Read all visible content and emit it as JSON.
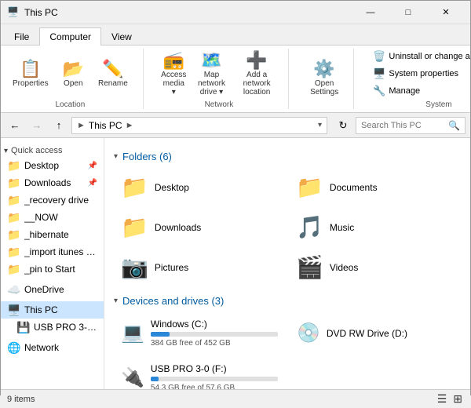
{
  "titleBar": {
    "title": "This PC",
    "icon": "🖥️",
    "minBtn": "—",
    "maxBtn": "□",
    "closeBtn": "✕"
  },
  "ribbon": {
    "tabs": [
      "File",
      "Computer",
      "View"
    ],
    "activeTab": "Computer",
    "groups": {
      "location": {
        "label": "Location",
        "buttons": [
          {
            "label": "Properties",
            "icon": "📋"
          },
          {
            "label": "Open",
            "icon": "📂"
          },
          {
            "label": "Rename",
            "icon": "✏️"
          }
        ]
      },
      "network": {
        "label": "Network",
        "buttons": [
          {
            "label": "Access media",
            "icon": "📻"
          },
          {
            "label": "Map network drive",
            "icon": "🗺️"
          },
          {
            "label": "Add a network location",
            "icon": "➕"
          }
        ]
      },
      "settings": {
        "label": "",
        "buttons": [
          {
            "label": "Open Settings",
            "icon": "⚙️"
          }
        ]
      },
      "system": {
        "label": "System",
        "sideBtns": [
          {
            "label": "Uninstall or change a program",
            "icon": "🗑️"
          },
          {
            "label": "System properties",
            "icon": "🖥️"
          },
          {
            "label": "Manage",
            "icon": "🔧"
          }
        ]
      }
    }
  },
  "addressBar": {
    "backDisabled": false,
    "forwardDisabled": true,
    "upDisabled": false,
    "path": "This PC",
    "pathFull": " > This PC >",
    "refreshIcon": "↻",
    "searchPlaceholder": "Search This PC",
    "searchIcon": "🔍"
  },
  "sidebar": {
    "sections": [
      {
        "header": "Quick access",
        "expanded": true,
        "items": [
          {
            "label": "Desktop",
            "icon": "📁",
            "pinned": true,
            "color": "#e6a817"
          },
          {
            "label": "Downloads",
            "icon": "📁",
            "pinned": true,
            "color": "#3b8fc7"
          },
          {
            "label": "_recovery drive",
            "icon": "📁",
            "pinned": false,
            "color": "#e6a817"
          },
          {
            "label": "__NOW",
            "icon": "📁",
            "pinned": false,
            "color": "#e6a817"
          },
          {
            "label": "_hibernate",
            "icon": "📁",
            "pinned": false,
            "color": "#e6a817"
          },
          {
            "label": "_import itunes gro",
            "icon": "📁",
            "pinned": false,
            "color": "#e6a817"
          },
          {
            "label": "_pin to Start",
            "icon": "📁",
            "pinned": false,
            "color": "#e6a817"
          }
        ]
      },
      {
        "header": "OneDrive",
        "icon": "☁️",
        "items": []
      },
      {
        "header": "This PC",
        "icon": "🖥️",
        "selected": true,
        "items": [
          {
            "label": "USB PRO 3-0 (F:)",
            "icon": "💾",
            "color": "#555"
          }
        ]
      },
      {
        "header": "Network",
        "icon": "🌐",
        "items": []
      }
    ]
  },
  "content": {
    "folders": {
      "title": "Folders",
      "count": 6,
      "items": [
        {
          "name": "Desktop",
          "icon": "📁",
          "color": "#e8a000"
        },
        {
          "name": "Documents",
          "icon": "📁",
          "color": "#e8a000"
        },
        {
          "name": "Downloads",
          "icon": "📁",
          "color": "#3b8fc7"
        },
        {
          "name": "Music",
          "icon": "🎵",
          "color": "#e8a000"
        },
        {
          "name": "Pictures",
          "icon": "📷",
          "color": "#e8a000"
        },
        {
          "name": "Videos",
          "icon": "🎬",
          "color": "#cc4444"
        }
      ]
    },
    "drives": {
      "title": "Devices and drives",
      "count": 3,
      "items": [
        {
          "name": "Windows (C:)",
          "icon": "💻",
          "freeGB": 384,
          "totalGB": 452,
          "meta": "384 GB free of 452 GB",
          "fillPct": 15
        },
        {
          "name": "DVD RW Drive (D:)",
          "icon": "💿",
          "freeGB": null,
          "totalGB": null,
          "meta": "",
          "fillPct": 0
        },
        {
          "name": "USB PRO 3-0 (F:)",
          "icon": "🔌",
          "freeGB": 54.3,
          "totalGB": 57.6,
          "meta": "54.3 GB free of 57.6 GB",
          "fillPct": 6
        }
      ]
    }
  },
  "statusBar": {
    "itemCount": "9 items"
  }
}
